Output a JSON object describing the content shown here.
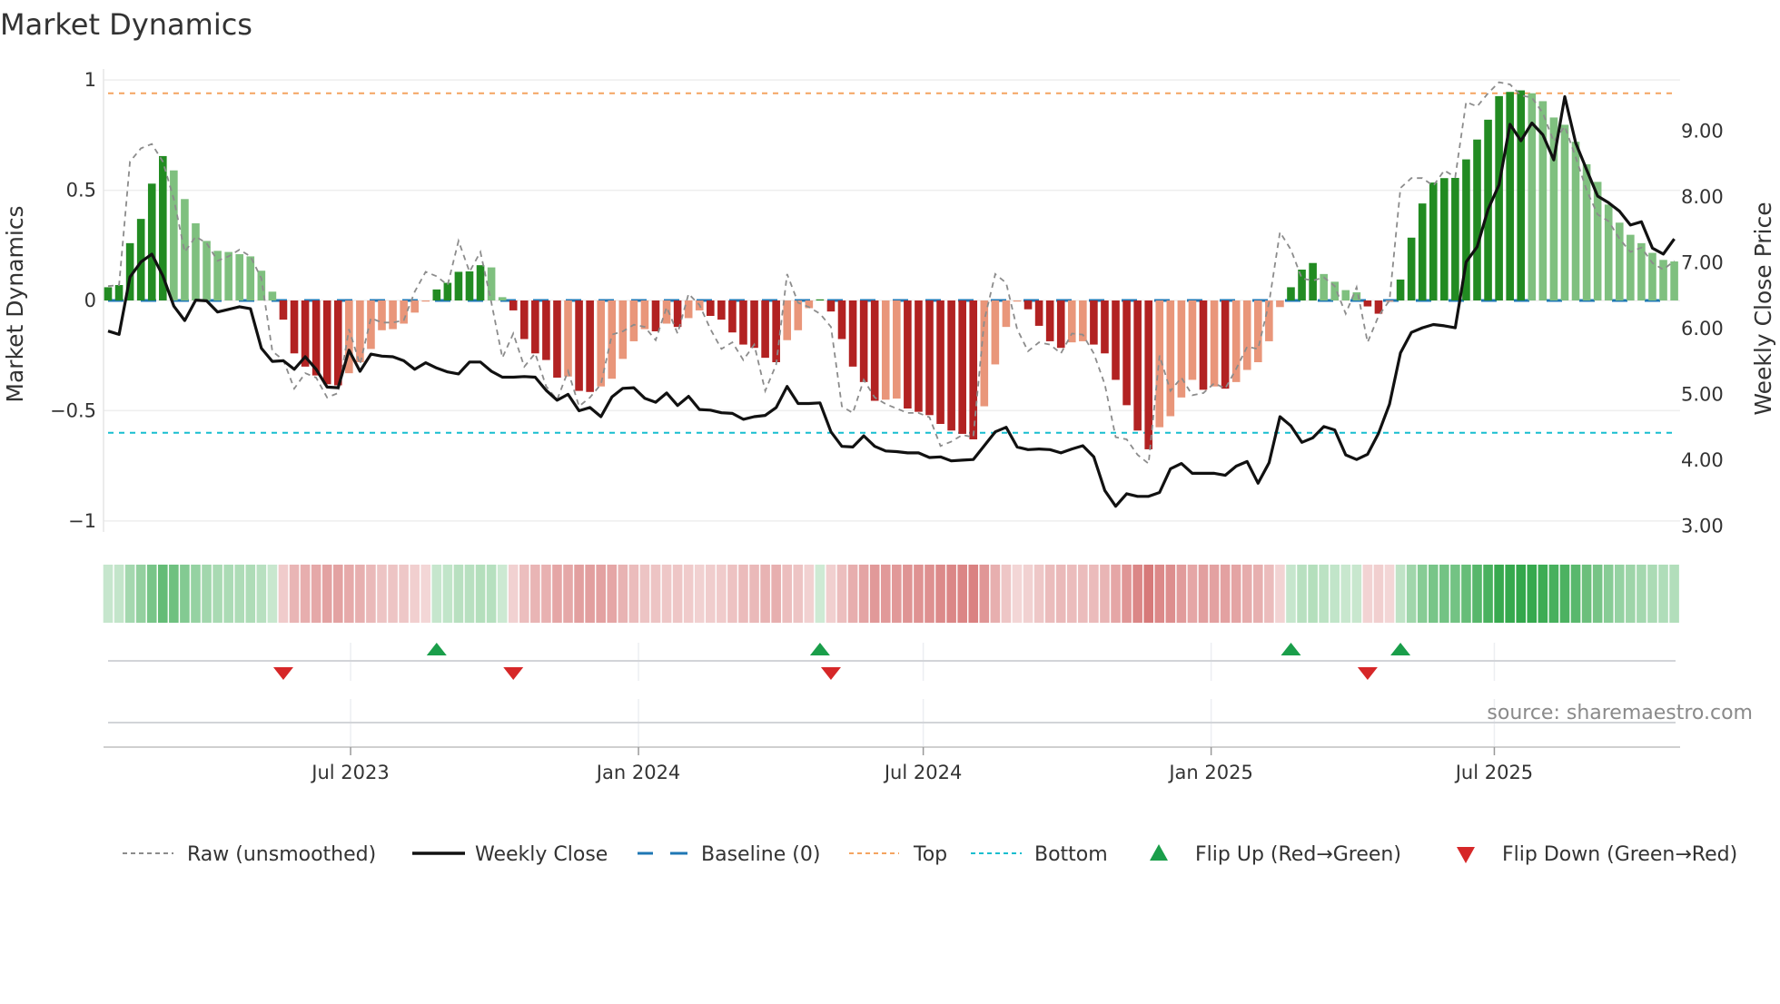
{
  "chart_data": {
    "type": "bar",
    "title": "Market Dynamics",
    "ylabel": "Market Dynamics",
    "y2label": "Weekly Close Price",
    "ylim": [
      -1.05,
      1.05
    ],
    "y2lim": [
      2.9,
      9.93
    ],
    "yticks": [
      1,
      0.5,
      0,
      -0.5,
      -1
    ],
    "ytick_labels": [
      "1",
      "0.5",
      "0",
      "−0.5",
      "−1"
    ],
    "y2ticks": [
      9,
      8,
      7,
      6,
      5,
      4,
      3
    ],
    "y2tick_labels": [
      "9.00",
      "8.00",
      "7.00",
      "6.00",
      "5.00",
      "4.00",
      "3.00"
    ],
    "x_start": "2023-01-27",
    "x_frequency": "weekly",
    "xticks": [
      "2023-07-01",
      "2024-01-01",
      "2024-07-01",
      "2025-01-01",
      "2025-07-01"
    ],
    "xtick_labels": [
      "Jul 2023",
      "Jan 2024",
      "Jul 2024",
      "Jan 2025",
      "Jul 2025"
    ],
    "top_level": 0.94,
    "bottom_level": -0.6,
    "baseline": 0,
    "series": [
      {
        "name": "Market Dynamics (smoothed)",
        "axis": "left",
        "kind": "bar",
        "values": [
          0.06,
          0.07,
          0.26,
          0.37,
          0.53,
          0.655,
          0.59,
          0.46,
          0.35,
          0.27,
          0.225,
          0.22,
          0.21,
          0.2,
          0.135,
          0.04,
          -0.087,
          -0.24,
          -0.3,
          -0.34,
          -0.38,
          -0.385,
          -0.33,
          -0.28,
          -0.22,
          -0.135,
          -0.13,
          -0.105,
          -0.055,
          -0.005,
          0.05,
          0.08,
          0.13,
          0.132,
          0.16,
          0.15,
          0.015,
          -0.045,
          -0.175,
          -0.24,
          -0.27,
          -0.35,
          -0.345,
          -0.41,
          -0.415,
          -0.39,
          -0.355,
          -0.265,
          -0.185,
          -0.13,
          -0.14,
          -0.105,
          -0.12,
          -0.08,
          -0.045,
          -0.07,
          -0.087,
          -0.145,
          -0.2,
          -0.215,
          -0.26,
          -0.28,
          -0.18,
          -0.135,
          -0.035,
          0.005,
          -0.05,
          -0.175,
          -0.3,
          -0.37,
          -0.455,
          -0.45,
          -0.445,
          -0.49,
          -0.505,
          -0.52,
          -0.56,
          -0.59,
          -0.605,
          -0.63,
          -0.48,
          -0.29,
          -0.12,
          -0.005,
          -0.04,
          -0.115,
          -0.185,
          -0.215,
          -0.19,
          -0.185,
          -0.2,
          -0.24,
          -0.36,
          -0.475,
          -0.59,
          -0.675,
          -0.575,
          -0.525,
          -0.44,
          -0.36,
          -0.405,
          -0.39,
          -0.4,
          -0.37,
          -0.315,
          -0.28,
          -0.185,
          -0.03,
          0.06,
          0.14,
          0.17,
          0.12,
          0.085,
          0.047,
          0.037,
          -0.027,
          -0.06,
          -0.005,
          0.095,
          0.285,
          0.44,
          0.535,
          0.555,
          0.556,
          0.64,
          0.73,
          0.82,
          0.927,
          0.946,
          0.953,
          0.94,
          0.904,
          0.83,
          0.797,
          0.72,
          0.618,
          0.538,
          0.435,
          0.353,
          0.298,
          0.26,
          0.216,
          0.184,
          0.177
        ]
      },
      {
        "name": "Raw (unsmoothed)",
        "axis": "left",
        "kind": "line",
        "values": [
          0.065,
          0.07,
          0.63,
          0.69,
          0.71,
          0.63,
          0.46,
          0.22,
          0.29,
          0.26,
          0.18,
          0.2,
          0.23,
          0.2,
          0.1,
          -0.23,
          -0.27,
          -0.4,
          -0.33,
          -0.35,
          -0.44,
          -0.42,
          -0.13,
          -0.29,
          -0.08,
          -0.1,
          -0.1,
          -0.09,
          0.04,
          0.13,
          0.11,
          0.07,
          0.27,
          0.13,
          0.22,
          -0.01,
          -0.26,
          -0.15,
          -0.3,
          -0.24,
          -0.39,
          -0.45,
          -0.32,
          -0.48,
          -0.44,
          -0.38,
          -0.155,
          -0.14,
          -0.11,
          -0.12,
          -0.18,
          -0.03,
          -0.15,
          0.03,
          -0.02,
          -0.13,
          -0.22,
          -0.19,
          -0.27,
          -0.2,
          -0.41,
          -0.29,
          0.12,
          -0.01,
          -0.03,
          -0.06,
          -0.12,
          -0.48,
          -0.51,
          -0.36,
          -0.44,
          -0.47,
          -0.49,
          -0.51,
          -0.51,
          -0.53,
          -0.66,
          -0.64,
          -0.61,
          -0.62,
          -0.09,
          0.12,
          0.08,
          -0.13,
          -0.23,
          -0.19,
          -0.2,
          -0.24,
          -0.15,
          -0.155,
          -0.24,
          -0.38,
          -0.62,
          -0.63,
          -0.7,
          -0.74,
          -0.25,
          -0.41,
          -0.35,
          -0.43,
          -0.42,
          -0.375,
          -0.4,
          -0.31,
          -0.21,
          -0.22,
          -0.01,
          0.31,
          0.23,
          0.1,
          0.09,
          0.105,
          0.065,
          -0.06,
          0.06,
          -0.19,
          -0.07,
          0.0,
          0.51,
          0.555,
          0.555,
          0.52,
          0.59,
          0.56,
          0.9,
          0.88,
          0.94,
          0.99,
          0.98,
          0.93,
          0.92,
          0.85,
          0.72,
          0.79,
          0.65,
          0.5,
          0.39,
          0.36,
          0.28,
          0.22,
          0.24,
          0.17,
          0.14,
          0.18
        ]
      },
      {
        "name": "Weekly Close",
        "axis": "right",
        "kind": "line",
        "values": [
          5.95,
          5.9,
          6.77,
          7.0,
          7.12,
          6.79,
          6.33,
          6.11,
          6.42,
          6.41,
          6.24,
          6.28,
          6.32,
          6.29,
          5.69,
          5.49,
          5.5,
          5.37,
          5.56,
          5.37,
          5.1,
          5.09,
          5.66,
          5.34,
          5.6,
          5.57,
          5.56,
          5.5,
          5.37,
          5.47,
          5.39,
          5.33,
          5.3,
          5.48,
          5.48,
          5.34,
          5.25,
          5.25,
          5.26,
          5.25,
          5.05,
          4.9,
          4.99,
          4.74,
          4.79,
          4.65,
          4.95,
          5.08,
          5.09,
          4.93,
          4.87,
          5.01,
          4.82,
          4.96,
          4.76,
          4.75,
          4.71,
          4.7,
          4.61,
          4.65,
          4.67,
          4.79,
          5.11,
          4.85,
          4.85,
          4.86,
          4.42,
          4.2,
          4.19,
          4.36,
          4.2,
          4.13,
          4.12,
          4.1,
          4.1,
          4.03,
          4.04,
          3.98,
          3.99,
          4.0,
          4.21,
          4.42,
          4.49,
          4.19,
          4.15,
          4.16,
          4.15,
          4.1,
          4.16,
          4.21,
          4.04,
          3.53,
          3.29,
          3.48,
          3.44,
          3.44,
          3.5,
          3.86,
          3.94,
          3.79,
          3.79,
          3.79,
          3.76,
          3.9,
          3.97,
          3.64,
          3.95,
          4.65,
          4.51,
          4.26,
          4.33,
          4.5,
          4.45,
          4.07,
          4.0,
          4.08,
          4.4,
          4.84,
          5.62,
          5.93,
          6.0,
          6.05,
          6.03,
          6.0,
          7.0,
          7.23,
          7.8,
          8.17,
          9.09,
          8.84,
          9.11,
          8.93,
          8.55,
          9.51,
          8.81,
          8.4,
          8.0,
          7.9,
          7.77,
          7.56,
          7.61,
          7.21,
          7.12,
          7.35
        ]
      }
    ],
    "flip_up_weeks": [
      31,
      66,
      109,
      119
    ],
    "flip_down_weeks": [
      17,
      38,
      67,
      116
    ],
    "legend": {
      "placement": "bottom",
      "entries": [
        "Raw (unsmoothed)",
        "Weekly Close",
        "Baseline (0)",
        "Top",
        "Bottom",
        "Flip Up (Red→Green)",
        "Flip Down (Green→Red)"
      ]
    },
    "annotation": "source: sharemaestro.com",
    "colors": {
      "pos_strong": "#228b22",
      "pos_weak": "#7fc07f",
      "neg_strong": "#b22222",
      "neg_weak": "#e9967a",
      "raw": "#8c8c8c",
      "close": "#111111",
      "baseline": "#1f77b4",
      "top": "#f4a460",
      "bottom": "#17becf",
      "flip_up": "#1a9e4a",
      "flip_down": "#d62728"
    }
  }
}
